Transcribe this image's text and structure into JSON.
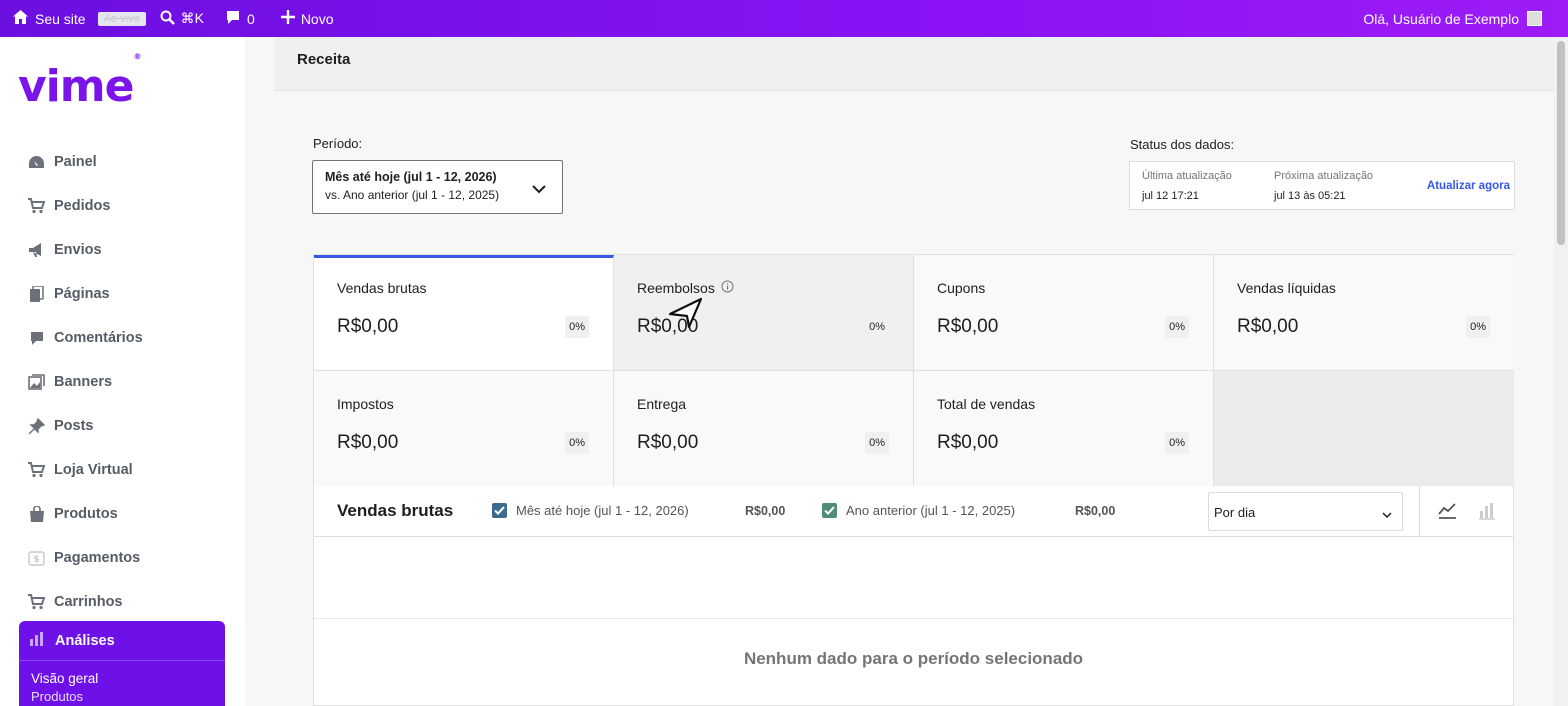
{
  "adminbar": {
    "site_label": "Seu site",
    "live_badge": "Ao vivo",
    "search_shortcut": "⌘K",
    "comments_count": "0",
    "new_label": "Novo",
    "greeting": "Olá, Usuário de Exemplo"
  },
  "sidebar": {
    "logo": "vime",
    "logo_mark": "®",
    "items": [
      {
        "label": "Painel",
        "icon": "dashboard-icon"
      },
      {
        "label": "Pedidos",
        "icon": "cart-icon"
      },
      {
        "label": "Envios",
        "icon": "megaphone-icon"
      },
      {
        "label": "Páginas",
        "icon": "pages-icon"
      },
      {
        "label": "Comentários",
        "icon": "comment-icon"
      },
      {
        "label": "Banners",
        "icon": "image-gallery-icon"
      },
      {
        "label": "Posts",
        "icon": "pin-icon"
      },
      {
        "label": "Loja Virtual",
        "icon": "cart-icon"
      },
      {
        "label": "Produtos",
        "icon": "shopping-bag-icon"
      },
      {
        "label": "Pagamentos",
        "icon": "dollar-icon"
      },
      {
        "label": "Carrinhos",
        "icon": "cart-icon"
      }
    ],
    "active": {
      "label": "Análises",
      "icon": "bar-chart-icon",
      "sub_items": [
        "Visão geral",
        "Produtos"
      ]
    }
  },
  "page": {
    "title": "Receita"
  },
  "period": {
    "label": "Período:",
    "line1": "Mês até hoje (jul 1 - 12, 2026)",
    "line2": "vs. Ano anterior (jul 1 - 12, 2025)"
  },
  "status": {
    "label": "Status dos dados:",
    "last_update_label": "Última atualização",
    "last_update_value": "jul 12 17:21",
    "next_update_label": "Próxima atualização",
    "next_update_value": "jul 13 às 05:21",
    "refresh_link": "Atualizar agora"
  },
  "kpis": [
    {
      "label": "Vendas brutas",
      "value": "R$0,00",
      "delta": "0%",
      "state": "selected"
    },
    {
      "label": "Reembolsos",
      "value": "R$0,00",
      "delta": "0%",
      "state": "hovered",
      "info": "info-icon"
    },
    {
      "label": "Cupons",
      "value": "R$0,00",
      "delta": "0%"
    },
    {
      "label": "Vendas líquidas",
      "value": "R$0,00",
      "delta": "0%"
    },
    {
      "label": "Impostos",
      "value": "R$0,00",
      "delta": "0%"
    },
    {
      "label": "Entrega",
      "value": "R$0,00",
      "delta": "0%"
    },
    {
      "label": "Total de vendas",
      "value": "R$0,00",
      "delta": "0%"
    }
  ],
  "chart": {
    "title": "Vendas brutas",
    "legend": [
      {
        "label": "Mês até hoje (jul 1 - 12, 2026)",
        "value": "R$0,00",
        "color": "#3d6a91",
        "checked": true
      },
      {
        "label": "Ano anterior (jul 1 - 12, 2025)",
        "value": "R$0,00",
        "color": "#4f8c79",
        "checked": true
      }
    ],
    "interval": "Por dia",
    "empty_message": "Nenhum dado para o período selecionado"
  },
  "colors": {
    "adminbar": "#7a12ea",
    "brand": "#7a14e8",
    "accent": "#3858e9"
  }
}
